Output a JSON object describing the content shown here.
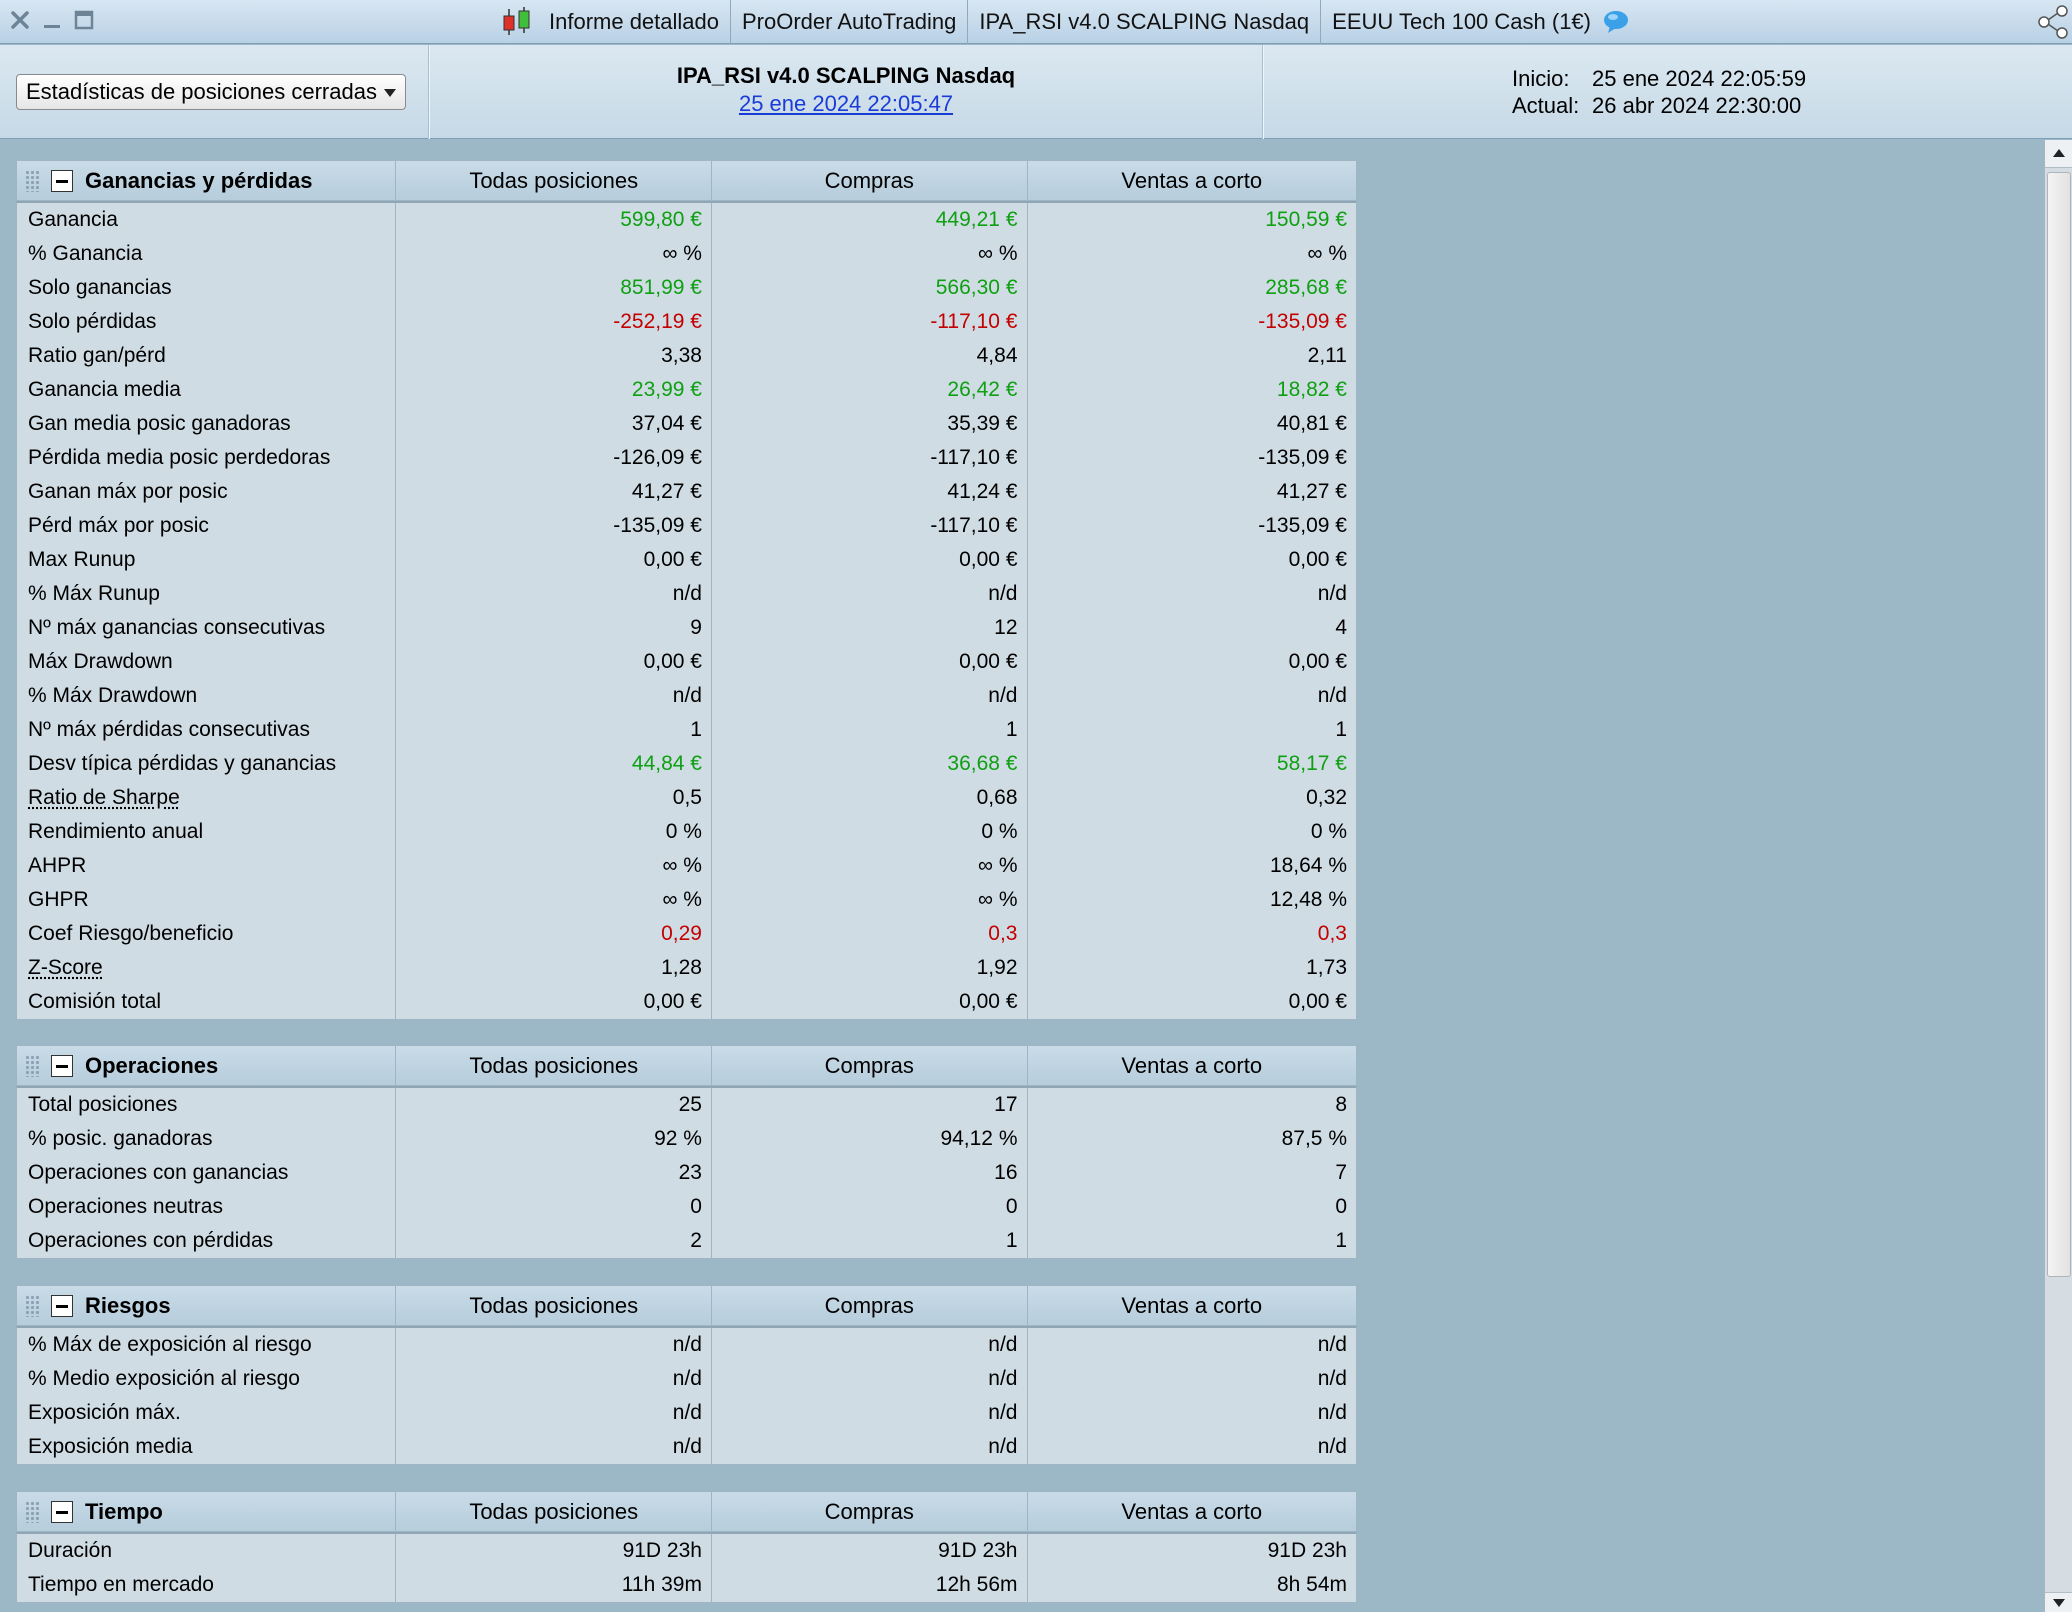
{
  "titlebar": {
    "crumbs": [
      "Informe detallado",
      "ProOrder AutoTrading",
      "IPA_RSI v4.0 SCALPING Nasdaq",
      "EEUU Tech 100 Cash (1€)"
    ]
  },
  "header": {
    "dropdown_value": "Estadísticas de posiciones cerradas",
    "strategy_name": "IPA_RSI v4.0 SCALPING Nasdaq",
    "strategy_date": "25 ene 2024 22:05:47",
    "start_label": "Inicio:",
    "start_value": "25 ene 2024 22:05:59",
    "current_label": "Actual:",
    "current_value": "26 abr 2024 22:30:00"
  },
  "colors": {
    "positive": "#0fa012",
    "negative": "#c40000",
    "link": "#1a3cd6"
  },
  "columns": [
    "Todas posiciones",
    "Compras",
    "Ventas a corto"
  ],
  "sections": [
    {
      "title": "Ganancias y pérdidas",
      "rows": [
        {
          "label": "Ganancia",
          "values": [
            "599,80 €",
            "449,21 €",
            "150,59 €"
          ],
          "tone": "pos"
        },
        {
          "label": "% Ganancia",
          "values": [
            "∞ %",
            "∞ %",
            "∞ %"
          ]
        },
        {
          "label": "Solo ganancias",
          "values": [
            "851,99 €",
            "566,30 €",
            "285,68 €"
          ],
          "tone": "pos"
        },
        {
          "label": "Solo pérdidas",
          "values": [
            "-252,19 €",
            "-117,10 €",
            "-135,09 €"
          ],
          "tone": "neg"
        },
        {
          "label": "Ratio gan/pérd",
          "values": [
            "3,38",
            "4,84",
            "2,11"
          ]
        },
        {
          "label": "Ganancia media",
          "values": [
            "23,99 €",
            "26,42 €",
            "18,82 €"
          ],
          "tone": "pos"
        },
        {
          "label": "Gan media posic ganadoras",
          "values": [
            "37,04 €",
            "35,39 €",
            "40,81 €"
          ]
        },
        {
          "label": "Pérdida media posic perdedoras",
          "values": [
            "-126,09 €",
            "-117,10 €",
            "-135,09 €"
          ]
        },
        {
          "label": "Ganan máx por posic",
          "values": [
            "41,27 €",
            "41,24 €",
            "41,27 €"
          ]
        },
        {
          "label": "Pérd máx por posic",
          "values": [
            "-135,09 €",
            "-117,10 €",
            "-135,09 €"
          ]
        },
        {
          "label": "Max Runup",
          "values": [
            "0,00 €",
            "0,00 €",
            "0,00 €"
          ]
        },
        {
          "label": "% Máx Runup",
          "values": [
            "n/d",
            "n/d",
            "n/d"
          ]
        },
        {
          "label": "Nº máx ganancias consecutivas",
          "values": [
            "9",
            "12",
            "4"
          ]
        },
        {
          "label": "Máx Drawdown",
          "values": [
            "0,00 €",
            "0,00 €",
            "0,00 €"
          ]
        },
        {
          "label": "% Máx Drawdown",
          "values": [
            "n/d",
            "n/d",
            "n/d"
          ]
        },
        {
          "label": "Nº máx pérdidas consecutivas",
          "values": [
            "1",
            "1",
            "1"
          ]
        },
        {
          "label": "Desv típica pérdidas y ganancias",
          "values": [
            "44,84 €",
            "36,68 €",
            "58,17 €"
          ],
          "tone": "pos"
        },
        {
          "label": "Ratio de Sharpe",
          "values": [
            "0,5",
            "0,68",
            "0,32"
          ],
          "link": true
        },
        {
          "label": "Rendimiento anual",
          "values": [
            "0 %",
            "0 %",
            "0 %"
          ]
        },
        {
          "label": "AHPR",
          "values": [
            "∞ %",
            "∞ %",
            "18,64 %"
          ]
        },
        {
          "label": "GHPR",
          "values": [
            "∞ %",
            "∞ %",
            "12,48 %"
          ]
        },
        {
          "label": "Coef Riesgo/beneficio",
          "values": [
            "0,29",
            "0,3",
            "0,3"
          ],
          "tone": "neg"
        },
        {
          "label": "Z-Score",
          "values": [
            "1,28",
            "1,92",
            "1,73"
          ],
          "link": true
        },
        {
          "label": "Comisión total",
          "values": [
            "0,00 €",
            "0,00 €",
            "0,00 €"
          ]
        }
      ]
    },
    {
      "title": "Operaciones",
      "rows": [
        {
          "label": "Total posiciones",
          "values": [
            "25",
            "17",
            "8"
          ]
        },
        {
          "label": "% posic. ganadoras",
          "values": [
            "92 %",
            "94,12 %",
            "87,5 %"
          ]
        },
        {
          "label": "Operaciones con ganancias",
          "values": [
            "23",
            "16",
            "7"
          ]
        },
        {
          "label": "Operaciones neutras",
          "values": [
            "0",
            "0",
            "0"
          ]
        },
        {
          "label": "Operaciones con pérdidas",
          "values": [
            "2",
            "1",
            "1"
          ]
        }
      ]
    },
    {
      "title": "Riesgos",
      "rows": [
        {
          "label": "% Máx de exposición al riesgo",
          "values": [
            "n/d",
            "n/d",
            "n/d"
          ]
        },
        {
          "label": "% Medio exposición al riesgo",
          "values": [
            "n/d",
            "n/d",
            "n/d"
          ]
        },
        {
          "label": "Exposición máx.",
          "values": [
            "n/d",
            "n/d",
            "n/d"
          ]
        },
        {
          "label": "Exposición media",
          "values": [
            "n/d",
            "n/d",
            "n/d"
          ]
        }
      ]
    },
    {
      "title": "Tiempo",
      "rows": [
        {
          "label": "Duración",
          "values": [
            "91D 23h",
            "91D 23h",
            "91D 23h"
          ]
        },
        {
          "label": "Tiempo en mercado",
          "values": [
            "11h 39m",
            "12h 56m",
            "8h 54m"
          ]
        }
      ]
    }
  ]
}
